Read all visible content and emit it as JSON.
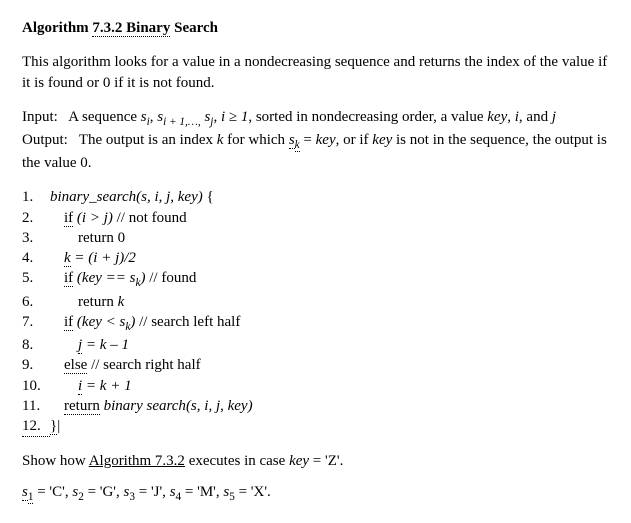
{
  "title": {
    "prefix": "Algorithm",
    "number": "7.3.2  Binary",
    "suffix": "Search"
  },
  "description": "This algorithm looks for a value in a nondecreasing sequence and returns the index of the value if it is found or 0 if it is not found.",
  "input": {
    "label": "Input:",
    "text_1": "A sequence ",
    "seq_si": "s",
    "seq_si_sub": "i",
    "seq_comma1": ", ",
    "seq_si1": "s",
    "seq_si1_sub": "i + 1,…,",
    "seq_sj": " s",
    "seq_sj_sub": "j",
    "seq_comma2": ", ",
    "cond": "i ≥ 1",
    "text_2": ", sorted in nondecreasing order, a value ",
    "key": "key",
    "text_3": ", ",
    "ivar": "i",
    "text_4": ", and ",
    "jvar": "j"
  },
  "output": {
    "label": "Output:",
    "text_1": "The output is an index ",
    "kvar": "k",
    "text_2": " for which ",
    "sk": "s",
    "sk_sub": "k",
    "eq": " = ",
    "key": "key",
    "text_3": ", or if ",
    "key2": "key",
    "text_4": " is not in the sequence, the output is the value 0."
  },
  "code": {
    "l1": {
      "n": "1.",
      "fn": "binary_search",
      "args": "(s, i, j, key)",
      "brace": " {"
    },
    "l2": {
      "n": "2.",
      "kw": "if",
      "cond": " (i > j)",
      "cmt": " // not found"
    },
    "l3": {
      "n": "3.",
      "ret": "return 0"
    },
    "l4": {
      "n": "4.",
      "kvar": "k",
      "eq": " = (i + j)/2"
    },
    "l5": {
      "n": "5.",
      "kw": "if",
      "cond1": " (key == s",
      "sub": "k",
      "cond2": ")",
      "cmt": " // found"
    },
    "l6": {
      "n": "6.",
      "ret": "return ",
      "kvar": "k"
    },
    "l7": {
      "n": "7.",
      "kw": "if",
      "cond1": " (key < s",
      "sub": "k",
      "cond2": ")",
      "cmt": " // search left half"
    },
    "l8": {
      "n": "8.",
      "jvar": "j",
      "eq": " = k – 1"
    },
    "l9": {
      "n": "9.",
      "kw": "else",
      "cmt": " // search right half"
    },
    "l10": {
      "n": "10.",
      "ivar": "i",
      "eq": " = k + 1"
    },
    "l11": {
      "n": "11.",
      "kw": "return",
      "fn": " binary search",
      "args": "(s, i, j, key)"
    },
    "l12": {
      "n": "12.",
      "brace": "}",
      "cursor": "|"
    }
  },
  "exercise": {
    "text_1": "Show how ",
    "alg": "Algorithm 7.3.2",
    "text_2": " executes in case ",
    "key": "key",
    "eq": " = 'Z'."
  },
  "values": {
    "s1": {
      "lbl": "s",
      "sub": "1",
      "eq": " = 'C',  "
    },
    "s2": {
      "lbl": "s",
      "sub": "2",
      "eq": " = 'G',  "
    },
    "s3": {
      "lbl": "s",
      "sub": "3",
      "eq": " = 'J',  "
    },
    "s4": {
      "lbl": "s",
      "sub": "4",
      "eq": " = 'M',  "
    },
    "s5": {
      "lbl": "s",
      "sub": "5",
      "eq": " = 'X'."
    }
  }
}
